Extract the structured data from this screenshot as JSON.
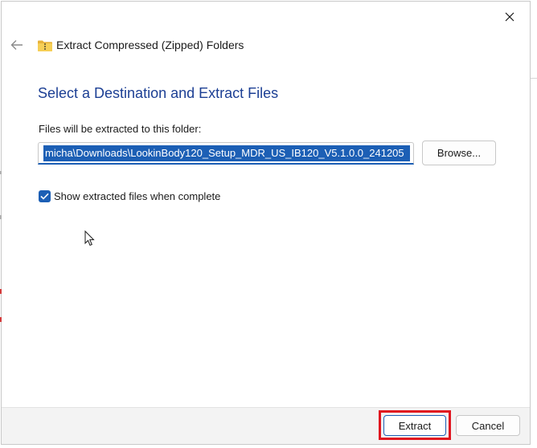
{
  "window": {
    "title": "Extract Compressed (Zipped) Folders",
    "close_icon": "close-icon",
    "back_icon": "back-arrow-icon",
    "folder_icon": "zipped-folder-icon"
  },
  "main": {
    "heading": "Select a Destination and Extract Files",
    "path_label": "Files will be extracted to this folder:",
    "path_value": "micha\\Downloads\\LookinBody120_Setup_MDR_US_IB120_V5.1.0.0_241205",
    "browse_label": "Browse...",
    "show_files_label": "Show extracted files when complete",
    "show_files_checked": true
  },
  "footer": {
    "extract_label": "Extract",
    "cancel_label": "Cancel"
  },
  "colors": {
    "accent": "#1c5fb5",
    "heading": "#1c3f94",
    "highlight": "#e0141f",
    "footer_bg": "#f3f3f3"
  }
}
